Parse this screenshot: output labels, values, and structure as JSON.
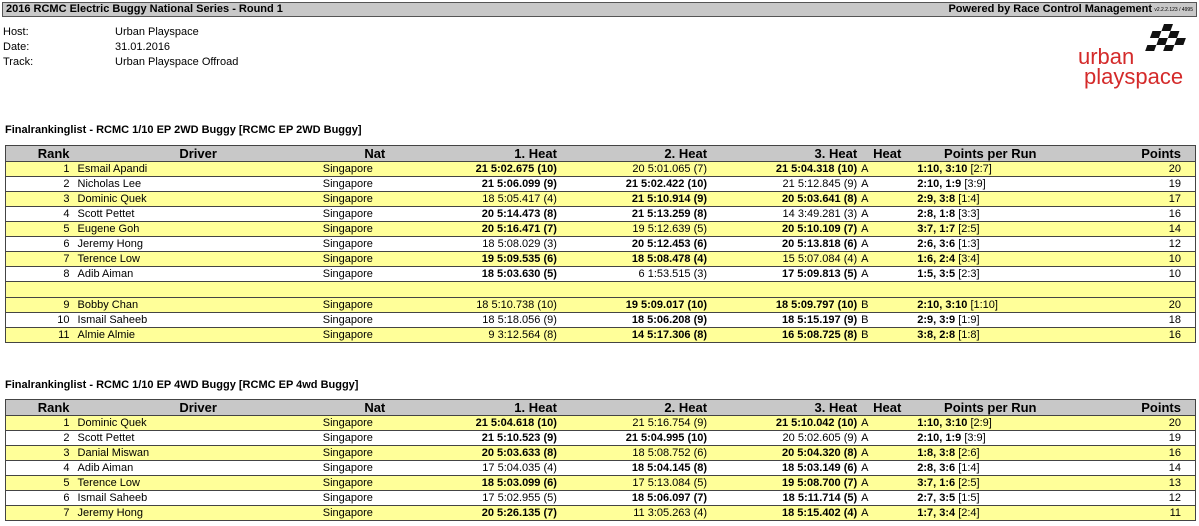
{
  "header": {
    "title": "2016 RCMC Electric Buggy National Series - Round 1",
    "powered_by": "Powered by Race Control Management",
    "version": "v2.2.2.123 / 4995"
  },
  "info": {
    "host_label": "Host:",
    "host": "Urban Playspace",
    "date_label": "Date:",
    "date": "31.01.2016",
    "track_label": "Track:",
    "track": "Urban Playspace Offroad"
  },
  "logo": {
    "line1": "urban",
    "line2": "playspace",
    "color": "#d42a2a"
  },
  "columns": {
    "rank": "Rank",
    "driver": "Driver",
    "nat": "Nat",
    "heat1": "1. Heat",
    "heat2": "2. Heat",
    "heat3": "3. Heat",
    "heat": "Heat",
    "ppr": "Points per Run",
    "points": "Points"
  },
  "sections": [
    {
      "title": "Finalrankinglist  -  RCMC 1/10 EP 2WD Buggy [RCMC EP 2WD Buggy]",
      "rows": [
        {
          "rank": "1",
          "driver": "Esmail Apandi",
          "nat": "Singapore",
          "h1": "21 5:02.675 (10)",
          "h1b": true,
          "h2": "20 5:01.065 (7)",
          "h2b": false,
          "h3": "21 5:04.318 (10)",
          "h3b": true,
          "heat": "A",
          "ppr_a": "1:10, 3:10",
          "ppr_b": "[2:7]",
          "points": "20"
        },
        {
          "rank": "2",
          "driver": "Nicholas Lee",
          "nat": "Singapore",
          "h1": "21 5:06.099 (9)",
          "h1b": true,
          "h2": "21 5:02.422 (10)",
          "h2b": true,
          "h3": "21 5:12.845 (9)",
          "h3b": false,
          "heat": "A",
          "ppr_a": "2:10, 1:9",
          "ppr_b": "[3:9]",
          "points": "19"
        },
        {
          "rank": "3",
          "driver": "Dominic Quek",
          "nat": "Singapore",
          "h1": "18 5:05.417 (4)",
          "h1b": false,
          "h2": "21 5:10.914 (9)",
          "h2b": true,
          "h3": "20 5:03.641 (8)",
          "h3b": true,
          "heat": "A",
          "ppr_a": "2:9, 3:8",
          "ppr_b": "[1:4]",
          "points": "17"
        },
        {
          "rank": "4",
          "driver": "Scott Pettet",
          "nat": "Singapore",
          "h1": "20 5:14.473 (8)",
          "h1b": true,
          "h2": "21 5:13.259 (8)",
          "h2b": true,
          "h3": "14 3:49.281 (3)",
          "h3b": false,
          "heat": "A",
          "ppr_a": "2:8, 1:8",
          "ppr_b": "[3:3]",
          "points": "16"
        },
        {
          "rank": "5",
          "driver": "Eugene Goh",
          "nat": "Singapore",
          "h1": "20 5:16.471 (7)",
          "h1b": true,
          "h2": "19 5:12.639 (5)",
          "h2b": false,
          "h3": "20 5:10.109 (7)",
          "h3b": true,
          "heat": "A",
          "ppr_a": "3:7, 1:7",
          "ppr_b": "[2:5]",
          "points": "14"
        },
        {
          "rank": "6",
          "driver": "Jeremy Hong",
          "nat": "Singapore",
          "h1": "18 5:08.029 (3)",
          "h1b": false,
          "h2": "20 5:12.453 (6)",
          "h2b": true,
          "h3": "20 5:13.818 (6)",
          "h3b": true,
          "heat": "A",
          "ppr_a": "2:6, 3:6",
          "ppr_b": "[1:3]",
          "points": "12"
        },
        {
          "rank": "7",
          "driver": "Terence Low",
          "nat": "Singapore",
          "h1": "19 5:09.535 (6)",
          "h1b": true,
          "h2": "18 5:08.478 (4)",
          "h2b": true,
          "h3": "15 5:07.084 (4)",
          "h3b": false,
          "heat": "A",
          "ppr_a": "1:6, 2:4",
          "ppr_b": "[3:4]",
          "points": "10"
        },
        {
          "rank": "8",
          "driver": "Adib Aiman",
          "nat": "Singapore",
          "h1": "18 5:03.630 (5)",
          "h1b": true,
          "h2": "6 1:53.515 (3)",
          "h2b": false,
          "h3": "17 5:09.813 (5)",
          "h3b": true,
          "heat": "A",
          "ppr_a": "1:5, 3:5",
          "ppr_b": "[2:3]",
          "points": "10"
        },
        {
          "gap": true
        },
        {
          "rank": "9",
          "driver": "Bobby Chan",
          "nat": "Singapore",
          "h1": "18 5:10.738 (10)",
          "h1b": false,
          "h2": "19 5:09.017 (10)",
          "h2b": true,
          "h3": "18 5:09.797 (10)",
          "h3b": true,
          "heat": "B",
          "ppr_a": "2:10, 3:10",
          "ppr_b": "[1:10]",
          "points": "20"
        },
        {
          "rank": "10",
          "driver": "Ismail Saheeb",
          "nat": "Singapore",
          "h1": "18 5:18.056 (9)",
          "h1b": false,
          "h2": "18 5:06.208 (9)",
          "h2b": true,
          "h3": "18 5:15.197 (9)",
          "h3b": true,
          "heat": "B",
          "ppr_a": "2:9, 3:9",
          "ppr_b": "[1:9]",
          "points": "18"
        },
        {
          "rank": "11",
          "driver": "Almie Almie",
          "nat": "Singapore",
          "h1": "9 3:12.564 (8)",
          "h1b": false,
          "h2": "14 5:17.306 (8)",
          "h2b": true,
          "h3": "16 5:08.725 (8)",
          "h3b": true,
          "heat": "B",
          "ppr_a": "3:8, 2:8",
          "ppr_b": "[1:8]",
          "points": "16"
        }
      ]
    },
    {
      "title": "Finalrankinglist  -  RCMC 1/10 EP 4WD Buggy [RCMC EP 4wd Buggy]",
      "rows": [
        {
          "rank": "1",
          "driver": "Dominic Quek",
          "nat": "Singapore",
          "h1": "21 5:04.618 (10)",
          "h1b": true,
          "h2": "21 5:16.754 (9)",
          "h2b": false,
          "h3": "21 5:10.042 (10)",
          "h3b": true,
          "heat": "A",
          "ppr_a": "1:10, 3:10",
          "ppr_b": "[2:9]",
          "points": "20"
        },
        {
          "rank": "2",
          "driver": "Scott Pettet",
          "nat": "Singapore",
          "h1": "21 5:10.523 (9)",
          "h1b": true,
          "h2": "21 5:04.995 (10)",
          "h2b": true,
          "h3": "20 5:02.605 (9)",
          "h3b": false,
          "heat": "A",
          "ppr_a": "2:10, 1:9",
          "ppr_b": "[3:9]",
          "points": "19"
        },
        {
          "rank": "3",
          "driver": "Danial Miswan",
          "nat": "Singapore",
          "h1": "20 5:03.633 (8)",
          "h1b": true,
          "h2": "18 5:08.752 (6)",
          "h2b": false,
          "h3": "20 5:04.320 (8)",
          "h3b": true,
          "heat": "A",
          "ppr_a": "1:8, 3:8",
          "ppr_b": "[2:6]",
          "points": "16"
        },
        {
          "rank": "4",
          "driver": "Adib Aiman",
          "nat": "Singapore",
          "h1": "17 5:04.035 (4)",
          "h1b": false,
          "h2": "18 5:04.145 (8)",
          "h2b": true,
          "h3": "18 5:03.149 (6)",
          "h3b": true,
          "heat": "A",
          "ppr_a": "2:8, 3:6",
          "ppr_b": "[1:4]",
          "points": "14"
        },
        {
          "rank": "5",
          "driver": "Terence Low",
          "nat": "Singapore",
          "h1": "18 5:03.099 (6)",
          "h1b": true,
          "h2": "17 5:13.084 (5)",
          "h2b": false,
          "h3": "19 5:08.700 (7)",
          "h3b": true,
          "heat": "A",
          "ppr_a": "3:7, 1:6",
          "ppr_b": "[2:5]",
          "points": "13"
        },
        {
          "rank": "6",
          "driver": "Ismail Saheeb",
          "nat": "Singapore",
          "h1": "17 5:02.955 (5)",
          "h1b": false,
          "h2": "18 5:06.097 (7)",
          "h2b": true,
          "h3": "18 5:11.714 (5)",
          "h3b": true,
          "heat": "A",
          "ppr_a": "2:7, 3:5",
          "ppr_b": "[1:5]",
          "points": "12"
        },
        {
          "rank": "7",
          "driver": "Jeremy Hong",
          "nat": "Singapore",
          "h1": "20 5:26.135 (7)",
          "h1b": true,
          "h2": "11 3:05.263 (4)",
          "h2b": false,
          "h3": "18 5:15.402 (4)",
          "h3b": true,
          "heat": "A",
          "ppr_a": "1:7, 3:4",
          "ppr_b": "[2:4]",
          "points": "11"
        }
      ]
    }
  ]
}
